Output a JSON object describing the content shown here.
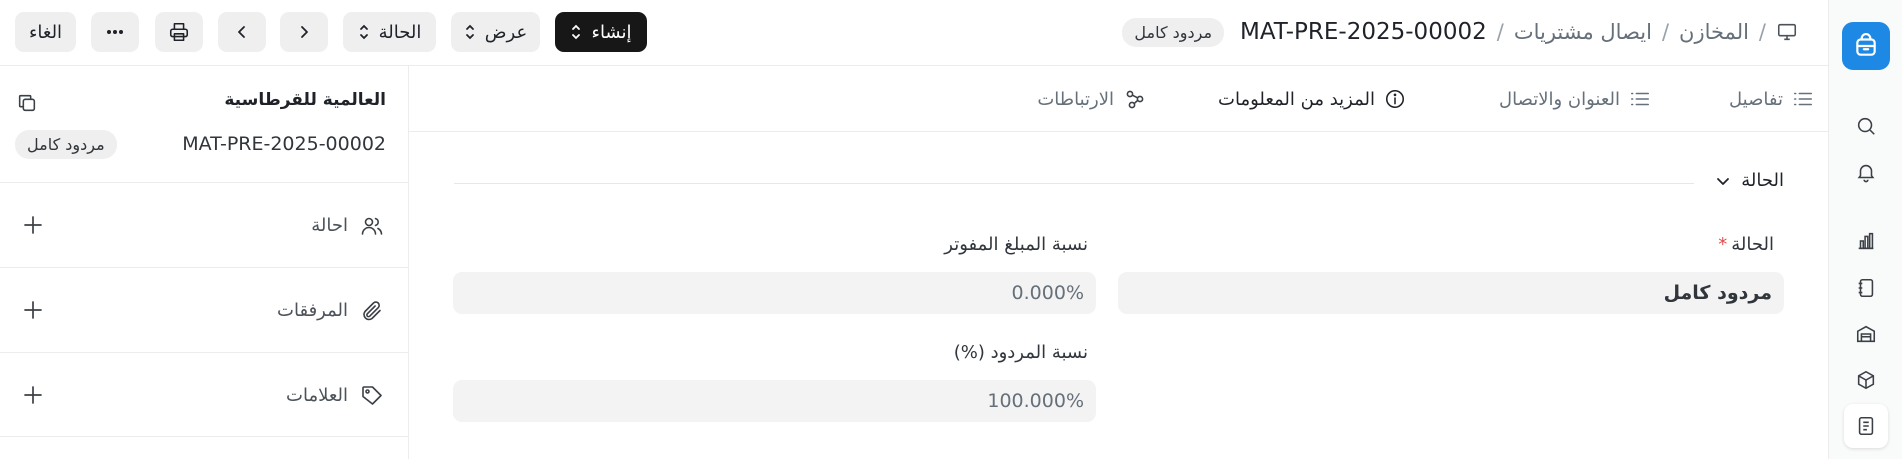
{
  "breadcrumb": {
    "module": "المخازن",
    "doctype": "ايصال مشتريات",
    "doc_id": "MAT-PRE-2025-00002",
    "status": "مردود كامل",
    "separator": "/"
  },
  "toolbar": {
    "create_label": "إنشاء",
    "view_label": "عرض",
    "status_label": "الحالة",
    "cancel_label": "الغاء"
  },
  "sidebar": {
    "supplier_name": "العالمية للقرطاسية",
    "doc_id": "MAT-PRE-2025-00002",
    "status": "مردود كامل",
    "rows": [
      {
        "label": "احالة",
        "icon": "users-icon"
      },
      {
        "label": "المرفقات",
        "icon": "paperclip-icon"
      },
      {
        "label": "العلامات",
        "icon": "tag-icon"
      }
    ]
  },
  "tabs": [
    {
      "label": "تفاصيل",
      "icon": "list-icon",
      "active": false
    },
    {
      "label": "العنوان والاتصال",
      "icon": "list-icon",
      "active": false
    },
    {
      "label": "المزيد من المعلومات",
      "icon": "info-icon",
      "active": true
    },
    {
      "label": "الارتباطات",
      "icon": "connections-icon",
      "active": false
    }
  ],
  "section": {
    "title": "الحالة",
    "status_label": "الحالة",
    "status_value": "مردود كامل",
    "billed_label": "نسبة المبلغ المفوتر",
    "billed_value": "0.000%",
    "returned_label": "نسبة المردود (%)",
    "returned_value": "100.000%"
  },
  "colors": {
    "accent": "#1e88e5",
    "primary_button": "#171717",
    "required": "#e24c4c"
  }
}
